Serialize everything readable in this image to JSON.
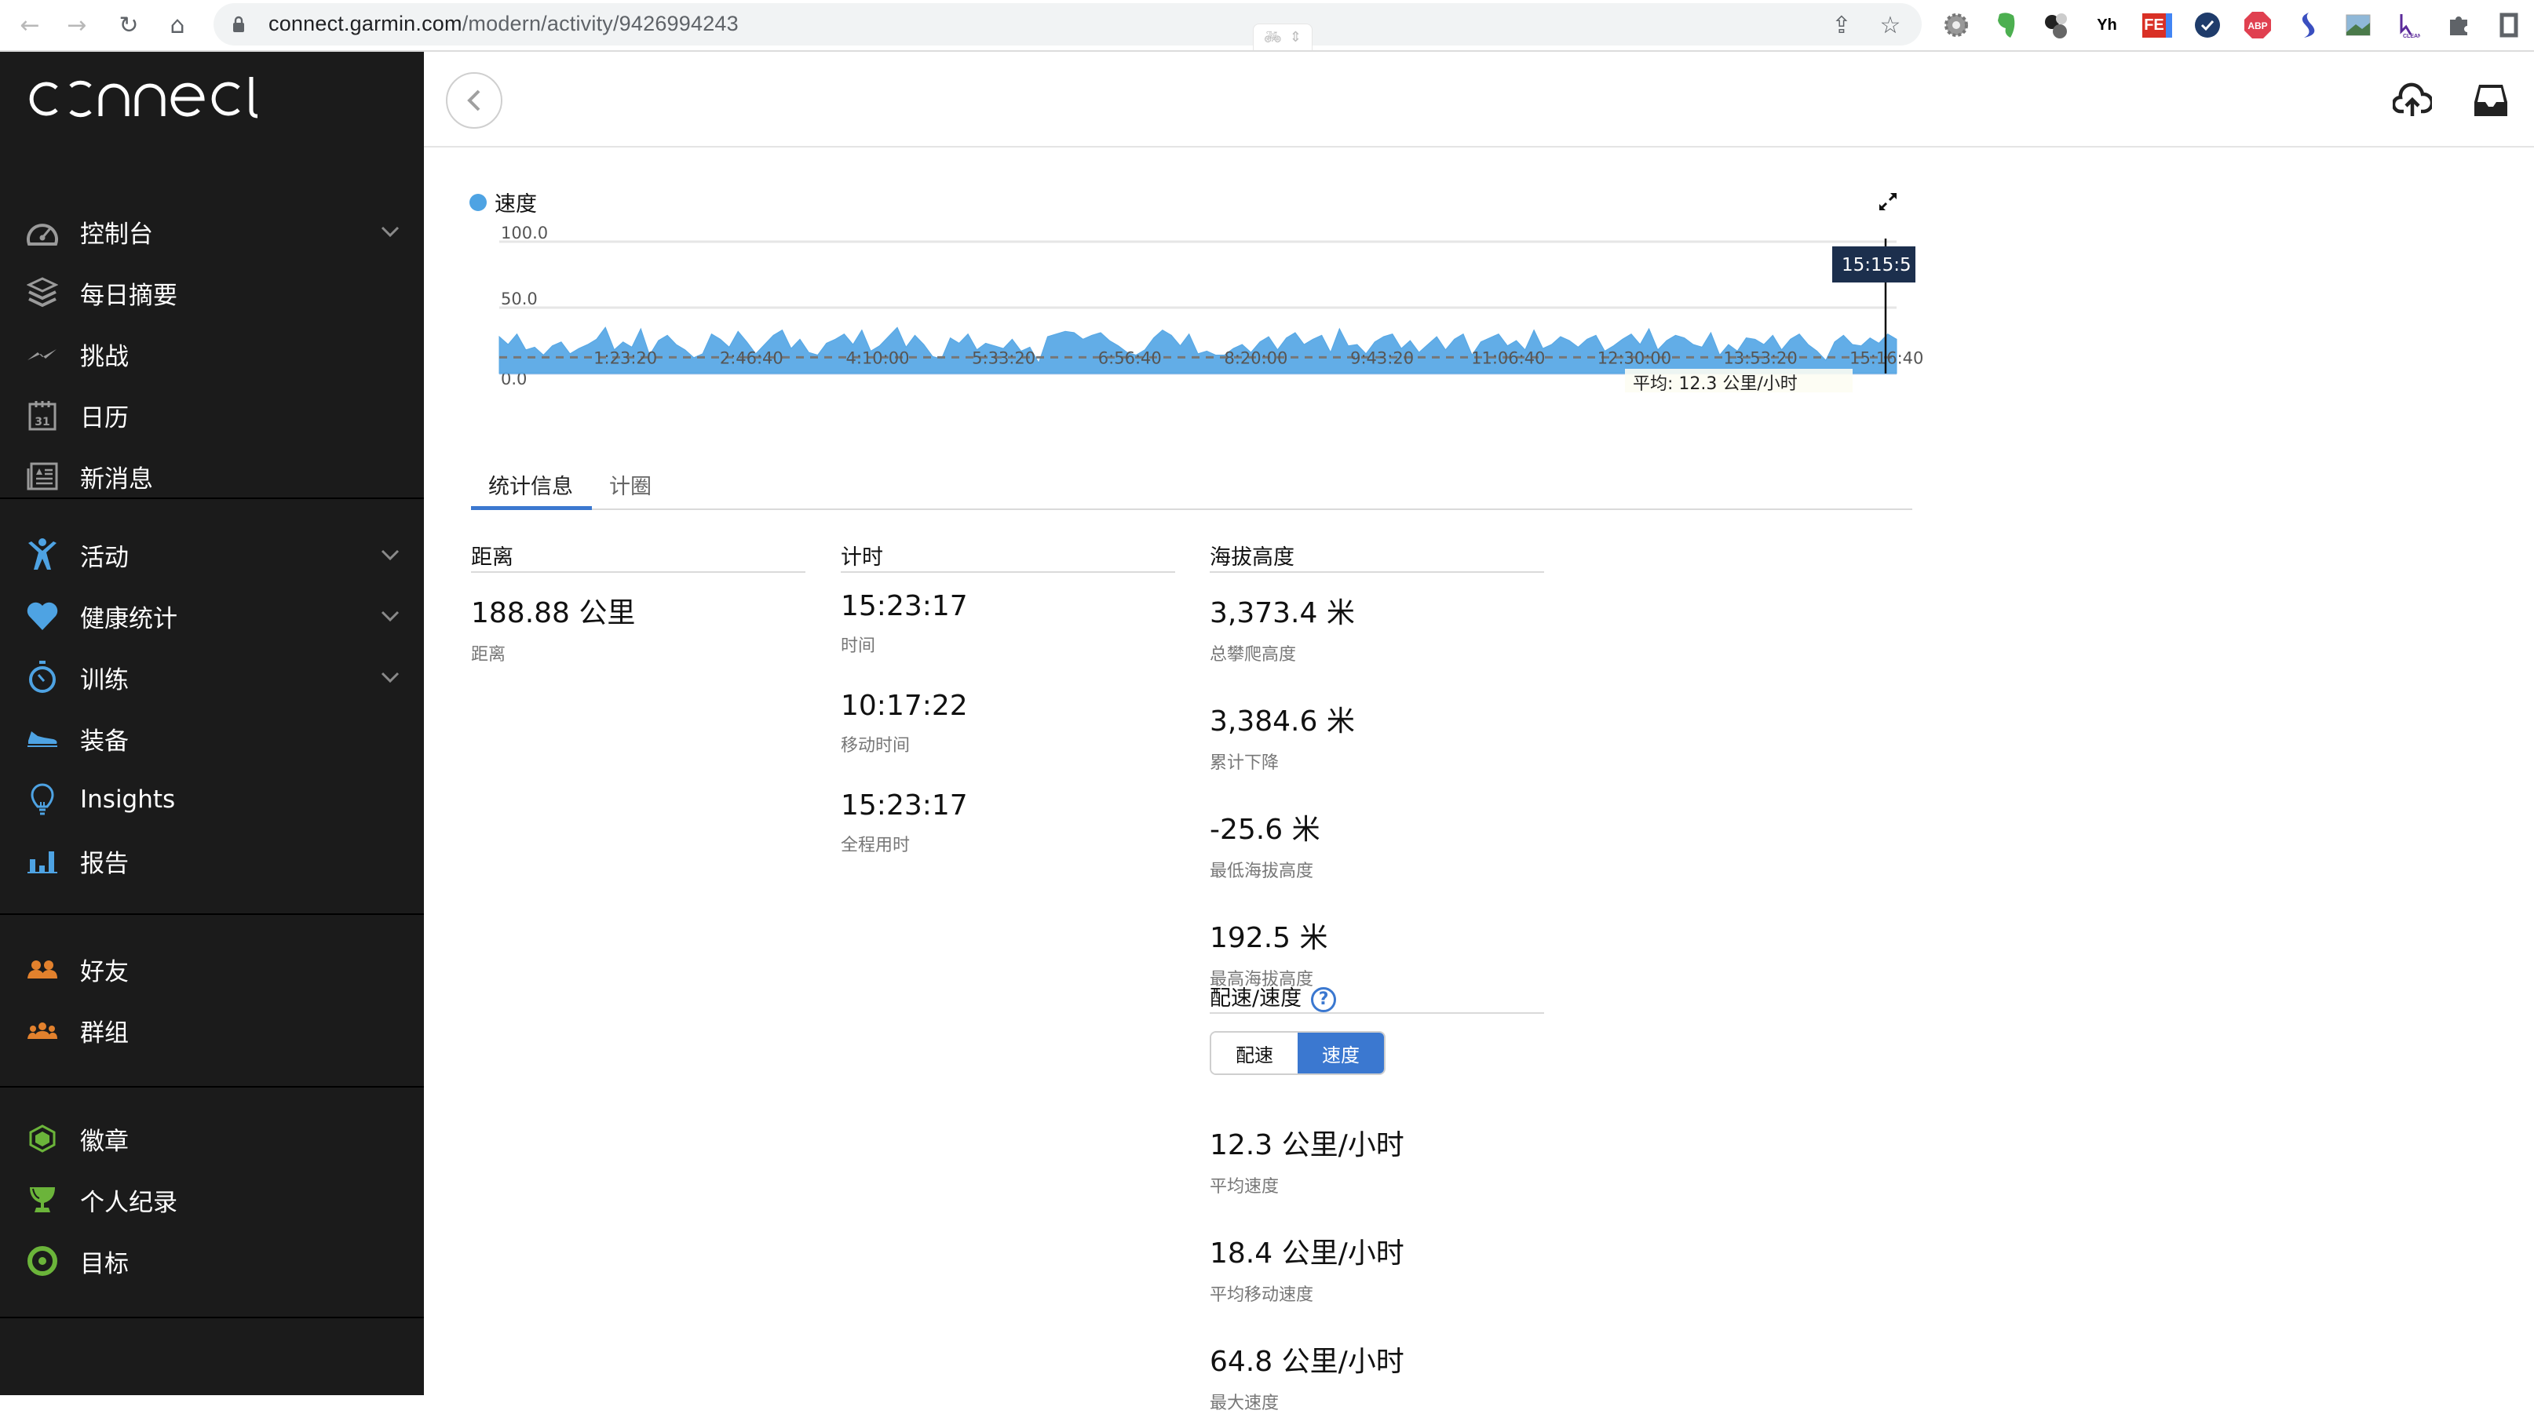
{
  "browser": {
    "url_host": "connect.garmin.com",
    "url_path": "/modern/activity/9426994243",
    "extensions": [
      "gear-extension",
      "evernote-extension",
      "balls-extension",
      "Yh",
      "FE",
      "check-extension",
      "ABP",
      "s-extension",
      "image-extension",
      "clean-extension",
      "puzzle-extension",
      "sidepanel-extension"
    ]
  },
  "sidebar": {
    "logo": "connect",
    "groups": [
      {
        "items": [
          {
            "label": "控制台",
            "icon": "dashboard-icon",
            "expandable": true
          },
          {
            "label": "每日摘要",
            "icon": "layers-icon",
            "expandable": false
          },
          {
            "label": "挑战",
            "icon": "challenge-icon",
            "expandable": false
          },
          {
            "label": "日历",
            "icon": "calendar-icon",
            "expandable": false
          },
          {
            "label": "新消息",
            "icon": "newsfeed-icon",
            "expandable": false
          }
        ]
      },
      {
        "items": [
          {
            "label": "活动",
            "icon": "activity-icon",
            "expandable": true
          },
          {
            "label": "健康统计",
            "icon": "heart-icon",
            "expandable": true
          },
          {
            "label": "训练",
            "icon": "stopwatch-icon",
            "expandable": true
          },
          {
            "label": "装备",
            "icon": "shoe-icon",
            "expandable": false
          },
          {
            "label": "Insights",
            "icon": "lightbulb-icon",
            "expandable": false
          },
          {
            "label": "报告",
            "icon": "bar-chart-icon",
            "expandable": false
          }
        ]
      },
      {
        "items": [
          {
            "label": "好友",
            "icon": "friends-icon",
            "expandable": false
          },
          {
            "label": "群组",
            "icon": "groups-icon",
            "expandable": false
          }
        ]
      },
      {
        "items": [
          {
            "label": "徽章",
            "icon": "badge-icon",
            "expandable": false
          },
          {
            "label": "个人纪录",
            "icon": "trophy-icon",
            "expandable": false
          },
          {
            "label": "目标",
            "icon": "target-icon",
            "expandable": false
          }
        ]
      }
    ],
    "colors": {
      "gray": "#9a9a9a",
      "blue": "#4ea3e3",
      "orange": "#e2812d",
      "green": "#6bb43a"
    }
  },
  "chart_data": {
    "type": "area",
    "legend": [
      {
        "name": "速度",
        "color": "#4ea3e3"
      }
    ],
    "ylim": [
      0,
      100
    ],
    "yticks": [
      "0.0",
      "50.0",
      "100.0"
    ],
    "xlabels": [
      "1:23:20",
      "2:46:40",
      "4:10:00",
      "5:33:20",
      "6:56:40",
      "8:20:00",
      "9:43:20",
      "11:06:40",
      "12:30:00",
      "13:53:20",
      "15:16:40"
    ],
    "x_range_seconds": [
      0,
      55397
    ],
    "average_line": {
      "value": 12.3,
      "label": "平均:  12.3 公里/小时"
    },
    "cursor_label": "15:15:5",
    "series": [
      {
        "name": "速度",
        "values": [
          28,
          22,
          30,
          18,
          20,
          14,
          21,
          24,
          15,
          19,
          22,
          26,
          35,
          18,
          24,
          20,
          34,
          14,
          25,
          29,
          22,
          18,
          12,
          15,
          30,
          26,
          20,
          32,
          24,
          15,
          22,
          29,
          33,
          19,
          26,
          16,
          14,
          23,
          26,
          30,
          22,
          33,
          17,
          21,
          28,
          35,
          20,
          29,
          22,
          13,
          11,
          27,
          23,
          30,
          18,
          23,
          21,
          19,
          26,
          17,
          20,
          8,
          28,
          30,
          32,
          31,
          26,
          29,
          31,
          25,
          21,
          16,
          14,
          18,
          27,
          33,
          29,
          21,
          30,
          15,
          17,
          14,
          14,
          19,
          22,
          16,
          24,
          28,
          18,
          27,
          31,
          22,
          26,
          29,
          16,
          34,
          21,
          22,
          15,
          24,
          28,
          30,
          19,
          25,
          16,
          22,
          28,
          18,
          26,
          30,
          14,
          24,
          27,
          30,
          21,
          25,
          18,
          33,
          19,
          22,
          28,
          25,
          20,
          26,
          29,
          17,
          21,
          26,
          30,
          22,
          34,
          18,
          25,
          29,
          27,
          22,
          20,
          31,
          14,
          22,
          17,
          27,
          26,
          22,
          29,
          18,
          26,
          30,
          22,
          17,
          10,
          24,
          29,
          22,
          21,
          27,
          23,
          30,
          26
        ]
      }
    ],
    "ylabel": "",
    "xlabel": "",
    "grid": true
  },
  "main": {
    "tabs": [
      {
        "label": "统计信息",
        "active": true
      },
      {
        "label": "计圈",
        "active": false
      }
    ],
    "stats": {
      "distance": {
        "title": "距离",
        "items": [
          {
            "value": "188.88 公里",
            "label": "距离"
          }
        ]
      },
      "timing": {
        "title": "计时",
        "items": [
          {
            "value": "15:23:17",
            "label": "时间"
          },
          {
            "value": "10:17:22",
            "label": "移动时间"
          },
          {
            "value": "15:23:17",
            "label": "全程用时"
          }
        ]
      },
      "elevation": {
        "title": "海拔高度",
        "items": [
          {
            "value": "3,373.4 米",
            "label": "总攀爬高度"
          },
          {
            "value": "3,384.6 米",
            "label": "累计下降"
          },
          {
            "value": "-25.6 米",
            "label": "最低海拔高度"
          },
          {
            "value": "192.5 米",
            "label": "最高海拔高度"
          }
        ]
      },
      "pace_speed": {
        "title": "配速/速度",
        "help": "?",
        "toggle": [
          {
            "label": "配速",
            "active": false
          },
          {
            "label": "速度",
            "active": true
          }
        ],
        "items": [
          {
            "value": "12.3 公里/小时",
            "label": "平均速度"
          },
          {
            "value": "18.4 公里/小时",
            "label": "平均移动速度"
          },
          {
            "value": "64.8 公里/小时",
            "label": "最大速度"
          }
        ]
      }
    }
  }
}
